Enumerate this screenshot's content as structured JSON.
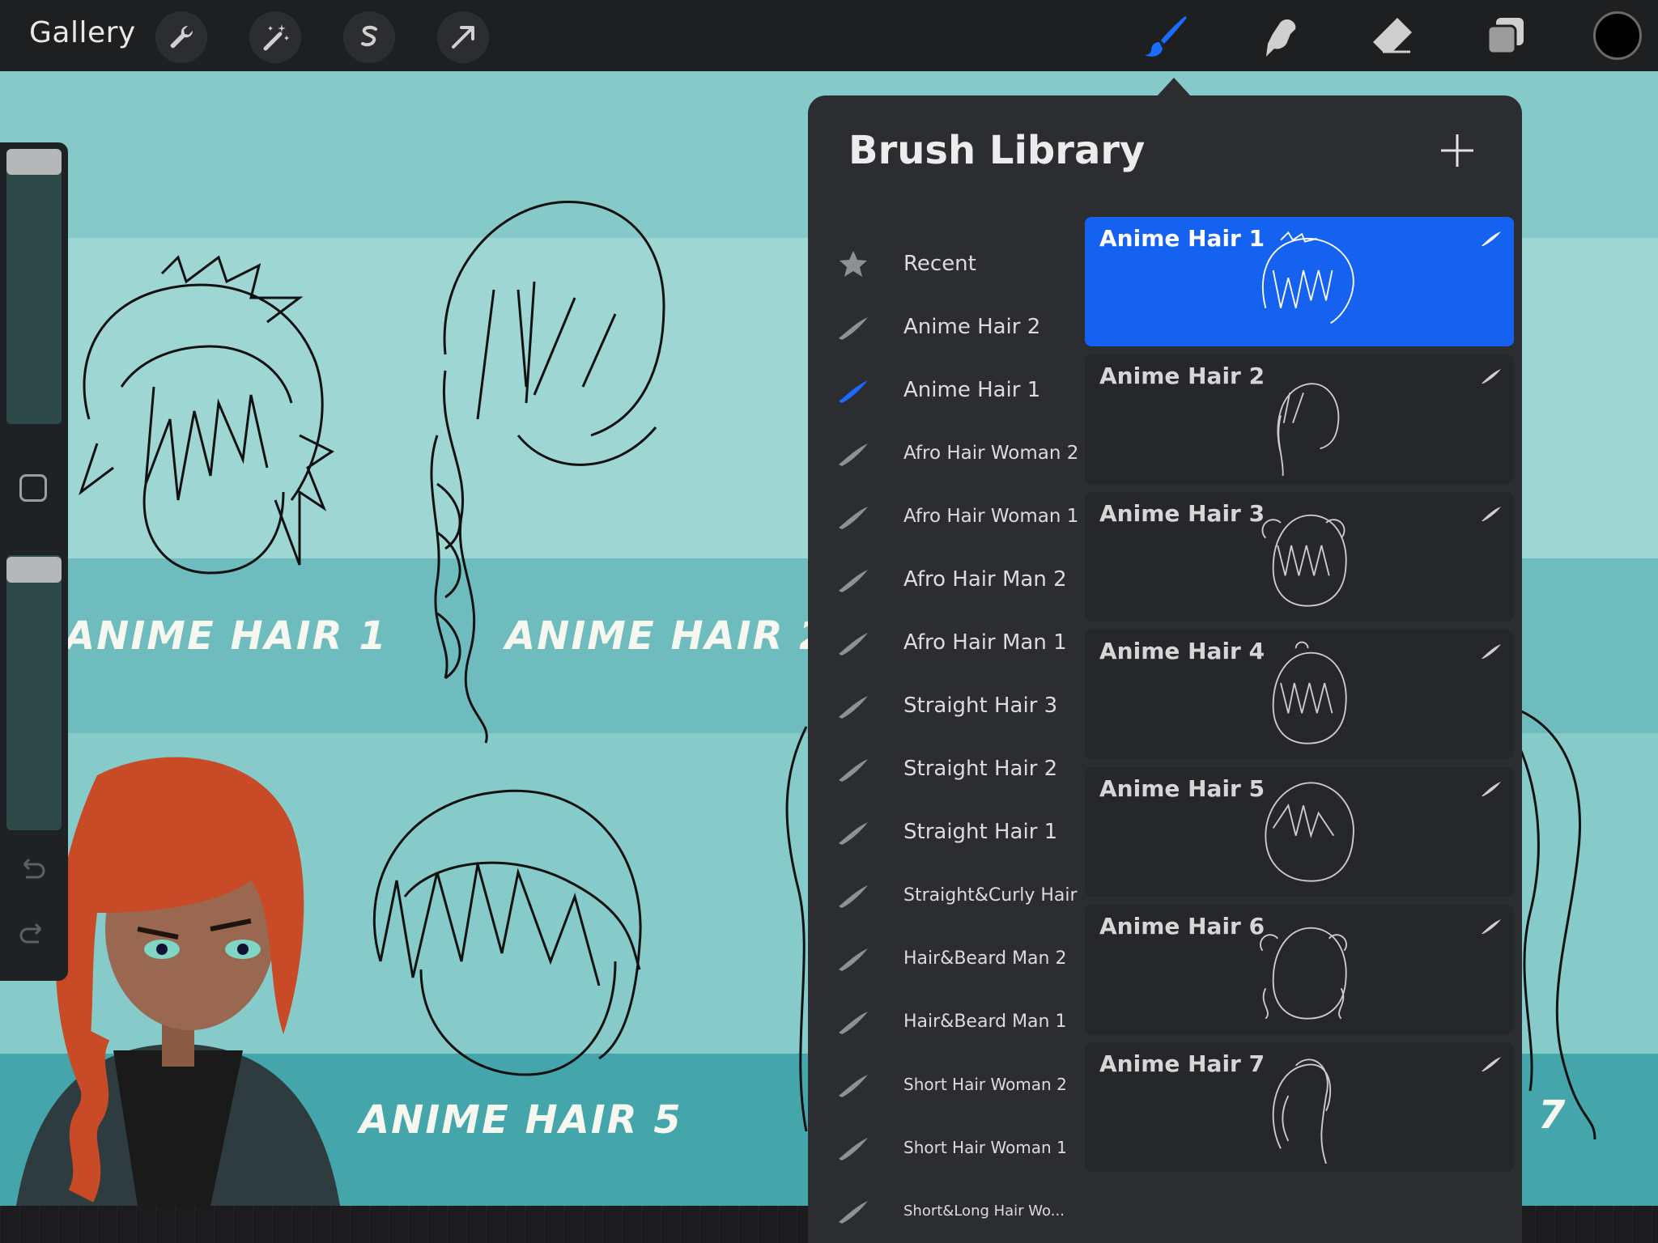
{
  "toolbar": {
    "gallery_label": "Gallery",
    "left_tools": [
      "wrench-icon",
      "magic-wand-icon",
      "selection-icon",
      "transform-arrow-icon"
    ],
    "right_tools": [
      "brush-icon",
      "smudge-icon",
      "eraser-icon",
      "layers-icon"
    ],
    "active_tool": "brush-icon",
    "current_color": "#000000"
  },
  "canvas": {
    "labels": [
      "ANIME HAIR 1",
      "ANIME HAIR 2",
      "ANIME HAIR 5",
      "7"
    ]
  },
  "sidebar": {
    "controls": [
      "brush-size-slider",
      "modify-button",
      "opacity-slider",
      "undo-icon",
      "redo-icon"
    ]
  },
  "brush_library": {
    "title": "Brush Library",
    "add_icon": "plus-icon",
    "brush_sets": [
      {
        "label": "Recent",
        "icon": "star-icon"
      },
      {
        "label": "Anime Hair 2",
        "icon": "brush-stroke-icon"
      },
      {
        "label": "Anime Hair 1",
        "icon": "brush-stroke-icon",
        "active": true
      },
      {
        "label": "Afro Hair Woman 2",
        "icon": "brush-stroke-icon"
      },
      {
        "label": "Afro Hair Woman 1",
        "icon": "brush-stroke-icon"
      },
      {
        "label": "Afro Hair Man 2",
        "icon": "brush-stroke-icon"
      },
      {
        "label": "Afro Hair Man 1",
        "icon": "brush-stroke-icon"
      },
      {
        "label": "Straight Hair 3",
        "icon": "brush-stroke-icon"
      },
      {
        "label": "Straight Hair 2",
        "icon": "brush-stroke-icon"
      },
      {
        "label": "Straight Hair 1",
        "icon": "brush-stroke-icon"
      },
      {
        "label": "Straight&Curly Hair",
        "icon": "brush-stroke-icon"
      },
      {
        "label": "Hair&Beard Man 2",
        "icon": "brush-stroke-icon"
      },
      {
        "label": "Hair&Beard Man 1",
        "icon": "brush-stroke-icon"
      },
      {
        "label": "Short Hair Woman 2",
        "icon": "brush-stroke-icon"
      },
      {
        "label": "Short Hair Woman 1",
        "icon": "brush-stroke-icon"
      },
      {
        "label": "Short&Long Hair Wo...",
        "icon": "brush-stroke-icon"
      }
    ],
    "brushes": [
      {
        "name": "Anime Hair 1",
        "selected": true
      },
      {
        "name": "Anime Hair 2"
      },
      {
        "name": "Anime Hair 3"
      },
      {
        "name": "Anime Hair 4"
      },
      {
        "name": "Anime Hair 5"
      },
      {
        "name": "Anime Hair 6"
      },
      {
        "name": "Anime Hair 7"
      }
    ]
  },
  "colors": {
    "accent": "#1662f0",
    "panel": "#2b2d31",
    "toolbar": "#1e1f21",
    "canvas_teal": "#7ec4c6"
  }
}
